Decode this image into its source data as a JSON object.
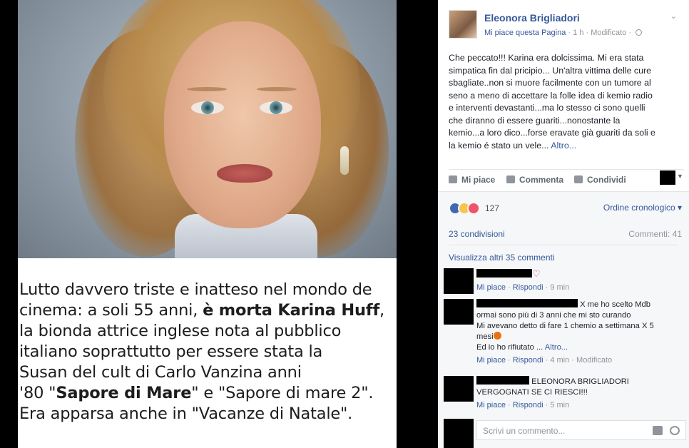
{
  "photo": {
    "caption_lines": [
      {
        "pre": "Lutto davvero triste e inatteso nel mondo de",
        "bold": "",
        "post": ""
      },
      {
        "pre": "cinema: a soli 55 anni, ",
        "bold": "è morta Karina Huff",
        "post": ","
      },
      {
        "pre": "la bionda attrice inglese nota al pubblico",
        "bold": "",
        "post": ""
      },
      {
        "pre": "italiano soprattutto per essere stata la",
        "bold": "",
        "post": ""
      },
      {
        "pre": "Susan del cult di Carlo Vanzina anni",
        "bold": "",
        "post": ""
      },
      {
        "pre": "'80 \"",
        "bold": "Sapore di Mare",
        "post": "\" e \"Sapore di mare 2\"."
      },
      {
        "pre": "Era apparsa anche in \"Vacanze di Natale\".",
        "bold": "",
        "post": ""
      }
    ]
  },
  "post": {
    "author": "Eleonora Brigliadori",
    "like_page": "Mi piace questa Pagina",
    "time": "1 h",
    "edited": "Modificato",
    "text_lines": [
      "Che peccato!!! Karina era dolcissima. Mi era stata",
      "simpatica fin dal pricipio... Un'altra vittima delle cure",
      "sbagliate..non si muore facilmente con un tumore al",
      "seno a meno di accettare la folle idea di kemio radio",
      "e interventi devastanti...ma lo stesso ci sono quelli",
      "che diranno di essere guariti...nonostante la",
      "kemio...a loro dico...forse eravate già guariti da soli e",
      "la kemio é stato un vele..."
    ],
    "more_label": "Altro...",
    "actions": {
      "like": "Mi piace",
      "comment": "Commenta",
      "share": "Condividi"
    }
  },
  "stats": {
    "reactions_count": "127",
    "order_label": "Ordine cronologico",
    "shares": "23 condivisioni",
    "comments": "Commenti: 41",
    "view_more": "Visualizza altri 35 commenti"
  },
  "comments": [
    {
      "line1_after": "",
      "lines": [],
      "like": "Mi piace",
      "reply": "Rispondi",
      "time": "9 min",
      "edited": ""
    },
    {
      "line1_after": "X me ho scelto Mdb",
      "lines": [
        "ormai sono più di 3 anni che mi sto curando",
        "Mi avevano detto di fare 1 chemio a settimana X 5",
        "mesi",
        "Ed io ho rifiutato ..."
      ],
      "more": "Altro...",
      "like": "Mi piace",
      "reply": "Rispondi",
      "time": "4 min",
      "edited": "Modificato"
    },
    {
      "line1_after": "ELEONORA BRIGLIADORI",
      "lines": [
        "VERGOGNATI SE CI RIESCI!!!"
      ],
      "like": "Mi piace",
      "reply": "Rispondi",
      "time": "5 min",
      "edited": ""
    }
  ],
  "reply_box": {
    "placeholder": "Scrivi un commento..."
  },
  "colors": {
    "link": "#365899",
    "like_reaction": "#4267b2",
    "love_reaction": "#f25268",
    "sad_reaction": "#f7c54a"
  },
  "icons": [
    "chevron-down-icon",
    "globe-icon",
    "like-icon",
    "comment-icon",
    "share-icon",
    "heart-icon",
    "angry-emoji-icon",
    "camera-icon",
    "emoji-icon"
  ]
}
